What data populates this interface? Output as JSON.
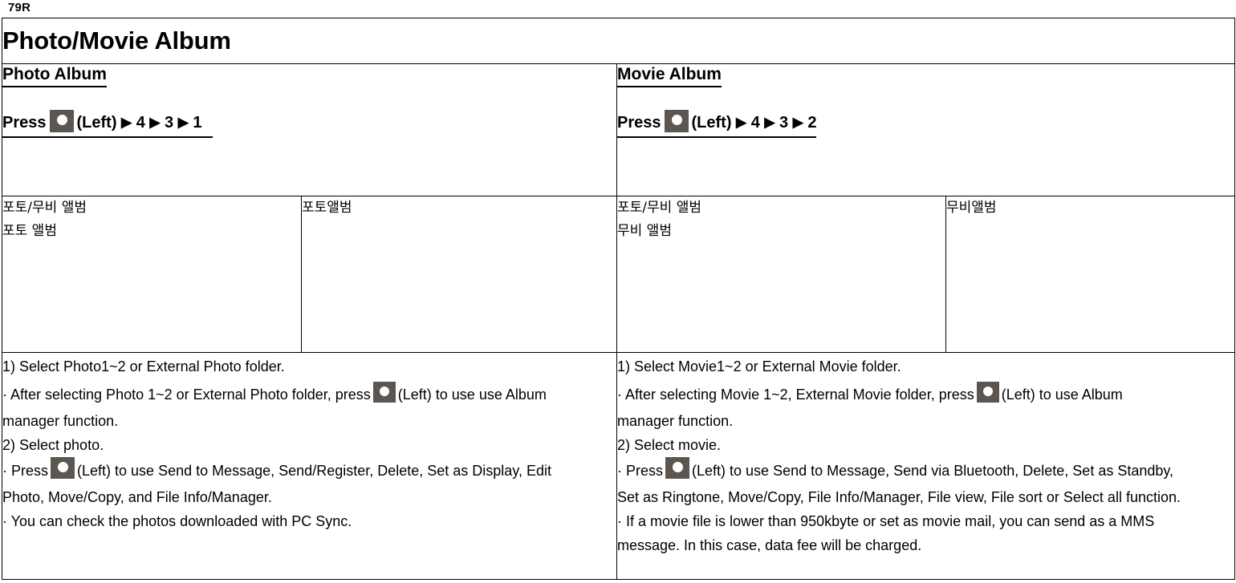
{
  "page_marker": "79R",
  "title": "Photo/Movie Album",
  "photo": {
    "heading": "Photo Album",
    "press_prefix": "Press",
    "press_key_icon": "left-soft-key-icon",
    "press_suffix_left": "(Left)",
    "arrow": "▶",
    "step1": "4",
    "step2": "3",
    "step3": "1",
    "kr_line1": "포토/무비 앨범",
    "kr_line2": "포토 앨범",
    "kr_menu": "포토앨범",
    "desc": {
      "l1": "1) Select Photo1~2 or External Photo folder.",
      "l2a": "· After selecting Photo 1~2 or External Photo folder, press",
      "l2b": "(Left) to use use Album",
      "l3": "manager function.",
      "l4": "2) Select photo.",
      "l5a": "· Press",
      "l5b": "(Left) to use Send to Message, Send/Register, Delete, Set as Display, Edit",
      "l6": "Photo, Move/Copy, and File Info/Manager.",
      "l7": "· You can check the photos downloaded with PC Sync."
    }
  },
  "movie": {
    "heading": "Movie Album",
    "press_prefix": "Press",
    "press_key_icon": "left-soft-key-icon",
    "press_suffix_left": "(Left)",
    "arrow": "▶",
    "step1": "4",
    "step2": "3",
    "step3": "2",
    "kr_line1": "포토/무비 앨범",
    "kr_line2": "무비 앨범",
    "kr_menu": "무비앨범",
    "desc": {
      "l1": "1) Select Movie1~2 or External Movie folder.",
      "l2a": "· After selecting Movie 1~2, External Movie folder, press",
      "l2b": "(Left) to use Album",
      "l3": "manager function.",
      "l4": "2) Select movie.",
      "l5a": "· Press",
      "l5b": "(Left) to use Send to Message, Send via Bluetooth, Delete, Set as Standby,",
      "l6": "Set as Ringtone, Move/Copy, File Info/Manager, File view, File sort or Select all function.",
      "l7": "· If a movie file is lower than 950kbyte or set as movie mail, you can send as a MMS",
      "l8": "message. In this case, data fee will be charged."
    }
  },
  "colors": {
    "key_icon_bg": "#5c5650",
    "key_icon_dot": "#ffffff",
    "border": "#000000",
    "text": "#000000"
  }
}
